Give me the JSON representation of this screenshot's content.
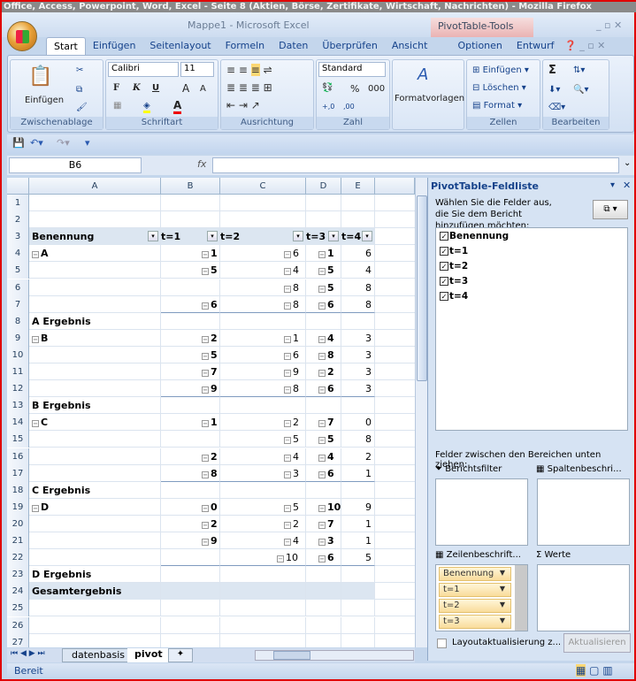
{
  "browser_title": "Office, Access, Powerpoint, Word, Excel - Seite 8 (Aktien, Börse, Zertifikate, Wirtschaft, Nachrichten) - Mozilla Firefox",
  "app_title": "Mappe1 - Microsoft Excel",
  "contextual_tab": "PivotTable-Tools",
  "tabs": [
    "Start",
    "Einfügen",
    "Seitenlayout",
    "Formeln",
    "Daten",
    "Überprüfen",
    "Ansicht",
    "Optionen",
    "Entwurf"
  ],
  "ribbon": {
    "clipboard": {
      "label": "Zwischenablage",
      "paste": "Einfügen"
    },
    "font": {
      "label": "Schriftart",
      "name": "Calibri",
      "size": "11",
      "bold": "F",
      "italic": "K",
      "underline": "U",
      "grow": "A",
      "shrink": "A",
      "color": "A"
    },
    "alignment": {
      "label": "Ausrichtung"
    },
    "number": {
      "label": "Zahl",
      "format": "Standard",
      "percent": "%",
      "thousands": "000",
      "inc": "+,0",
      "dec": ",00"
    },
    "styles": {
      "label": "Formatvorlagen"
    },
    "cells": {
      "label": "Zellen",
      "insert": "Einfügen",
      "delete": "Löschen",
      "format": "Format"
    },
    "editing": {
      "label": "Bearbeiten",
      "sum": "Σ"
    }
  },
  "formula_bar": {
    "name_box": "B6",
    "fx": "fx",
    "value": ""
  },
  "columns": [
    "A",
    "B",
    "C",
    "D",
    "E"
  ],
  "rows": [
    {
      "n": "1",
      "type": "empty"
    },
    {
      "n": "2",
      "type": "empty"
    },
    {
      "n": "3",
      "type": "hdr",
      "a": "Benennung",
      "b": "t=1",
      "c": "t=2",
      "d": "t=3",
      "e": "t=4"
    },
    {
      "n": "4",
      "type": "item",
      "a": "A",
      "b": "1",
      "c": "6",
      "d": "1",
      "e": "6"
    },
    {
      "n": "5",
      "type": "item",
      "b": "5",
      "c": "4",
      "d": "5",
      "e": "4"
    },
    {
      "n": "6",
      "type": "item",
      "c": "8",
      "d": "5",
      "e": "8"
    },
    {
      "n": "7",
      "type": "item",
      "b": "6",
      "c": "8",
      "d": "6",
      "e": "8",
      "line": true
    },
    {
      "n": "8",
      "type": "sub",
      "a": "A Ergebnis"
    },
    {
      "n": "9",
      "type": "item",
      "a": "B",
      "b": "2",
      "c": "1",
      "d": "4",
      "e": "3"
    },
    {
      "n": "10",
      "type": "item",
      "b": "5",
      "c": "6",
      "d": "8",
      "e": "3"
    },
    {
      "n": "11",
      "type": "item",
      "b": "7",
      "c": "9",
      "d": "2",
      "e": "3"
    },
    {
      "n": "12",
      "type": "item",
      "b": "9",
      "c": "8",
      "d": "6",
      "e": "3",
      "line": true
    },
    {
      "n": "13",
      "type": "sub",
      "a": "B Ergebnis"
    },
    {
      "n": "14",
      "type": "item",
      "a": "C",
      "b": "1",
      "c": "2",
      "d": "7",
      "e": "0"
    },
    {
      "n": "15",
      "type": "item",
      "c": "5",
      "d": "5",
      "e": "8"
    },
    {
      "n": "16",
      "type": "item",
      "b": "2",
      "c": "4",
      "d": "4",
      "e": "2"
    },
    {
      "n": "17",
      "type": "item",
      "b": "8",
      "c": "3",
      "d": "6",
      "e": "1",
      "line": true
    },
    {
      "n": "18",
      "type": "sub",
      "a": "C Ergebnis"
    },
    {
      "n": "19",
      "type": "item",
      "a": "D",
      "b": "0",
      "c": "5",
      "d": "10",
      "e": "9"
    },
    {
      "n": "20",
      "type": "item",
      "b": "2",
      "c": "2",
      "d": "7",
      "e": "1"
    },
    {
      "n": "21",
      "type": "item",
      "b": "9",
      "c": "4",
      "d": "3",
      "e": "1"
    },
    {
      "n": "22",
      "type": "item",
      "c": "10",
      "d": "6",
      "e": "5",
      "line": true
    },
    {
      "n": "23",
      "type": "sub",
      "a": "D Ergebnis"
    },
    {
      "n": "24",
      "type": "grand",
      "a": "Gesamtergebnis"
    },
    {
      "n": "25",
      "type": "empty"
    },
    {
      "n": "26",
      "type": "empty"
    },
    {
      "n": "27",
      "type": "empty"
    }
  ],
  "pivot_pane": {
    "title": "PivotTable-Feldliste",
    "instruction": "Wählen Sie die Felder aus, die Sie dem Bericht hinzufügen möchten:",
    "fields": [
      "Benennung",
      "t=1",
      "t=2",
      "t=3",
      "t=4"
    ],
    "drag_hint": "Felder zwischen den Bereichen unten ziehen:",
    "report_filter": "Berichtsfilter",
    "column_labels": "Spaltenbeschri...",
    "row_labels": "Zeilenbeschrift...",
    "values": "Werte",
    "row_items": [
      "Benennung",
      "t=1",
      "t=2",
      "t=3"
    ],
    "defer_update": "Layoutaktualisierung z...",
    "update_button": "Aktualisieren"
  },
  "sheets": [
    "datenbasis",
    "pivot"
  ],
  "active_sheet": "pivot",
  "status": "Bereit"
}
